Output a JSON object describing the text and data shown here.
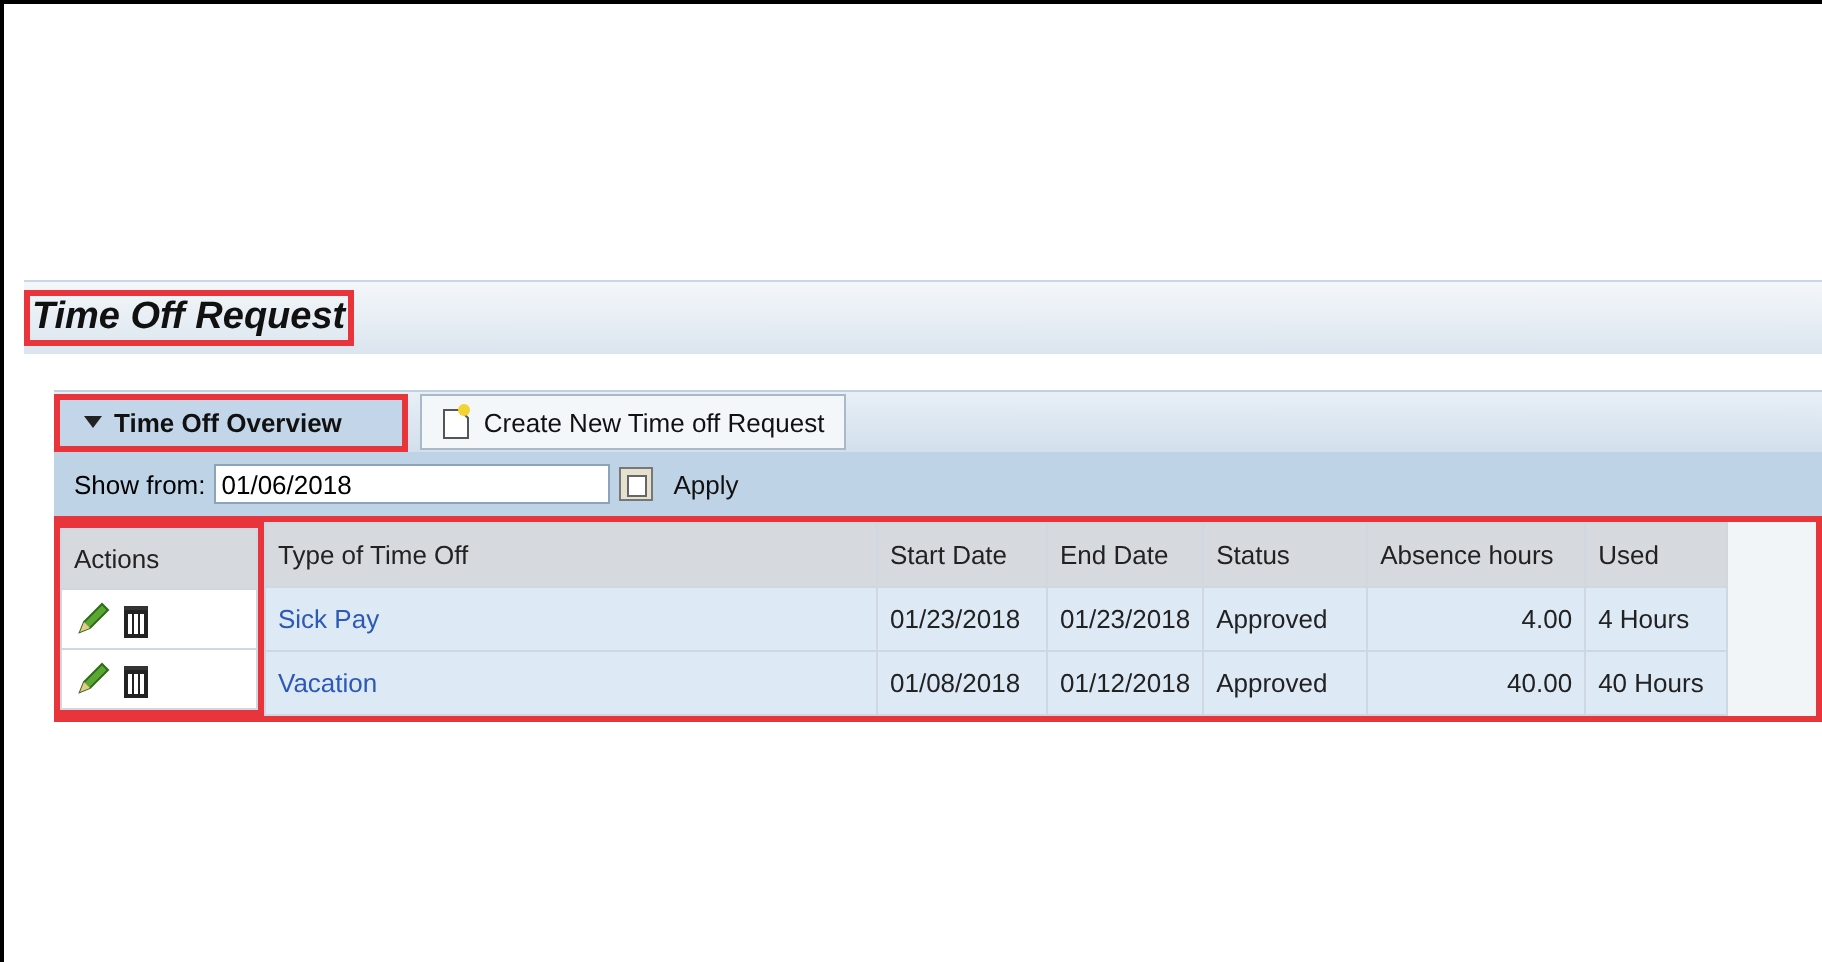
{
  "page": {
    "title": "Time Off Request",
    "highlighted": true
  },
  "tabs": [
    {
      "label": "Time Off Overview",
      "kind": "section",
      "selected": true,
      "highlighted": true
    },
    {
      "label": "Create New Time off Request",
      "kind": "action",
      "selected": false,
      "highlighted": false
    }
  ],
  "filter": {
    "label": "Show from:",
    "value": "01/06/2018",
    "apply": "Apply"
  },
  "table": {
    "highlighted": true,
    "actions_highlighted": true,
    "columns": [
      "Actions",
      "Type of Time Off",
      "Start Date",
      "End Date",
      "Status",
      "Absence hours",
      "Used"
    ],
    "rows": [
      {
        "type": "Sick Pay",
        "start": "01/23/2018",
        "end": "01/23/2018",
        "status": "Approved",
        "hours": "4.00",
        "used": "4 Hours"
      },
      {
        "type": "Vacation",
        "start": "01/08/2018",
        "end": "01/12/2018",
        "status": "Approved",
        "hours": "40.00",
        "used": "40 Hours"
      }
    ]
  }
}
